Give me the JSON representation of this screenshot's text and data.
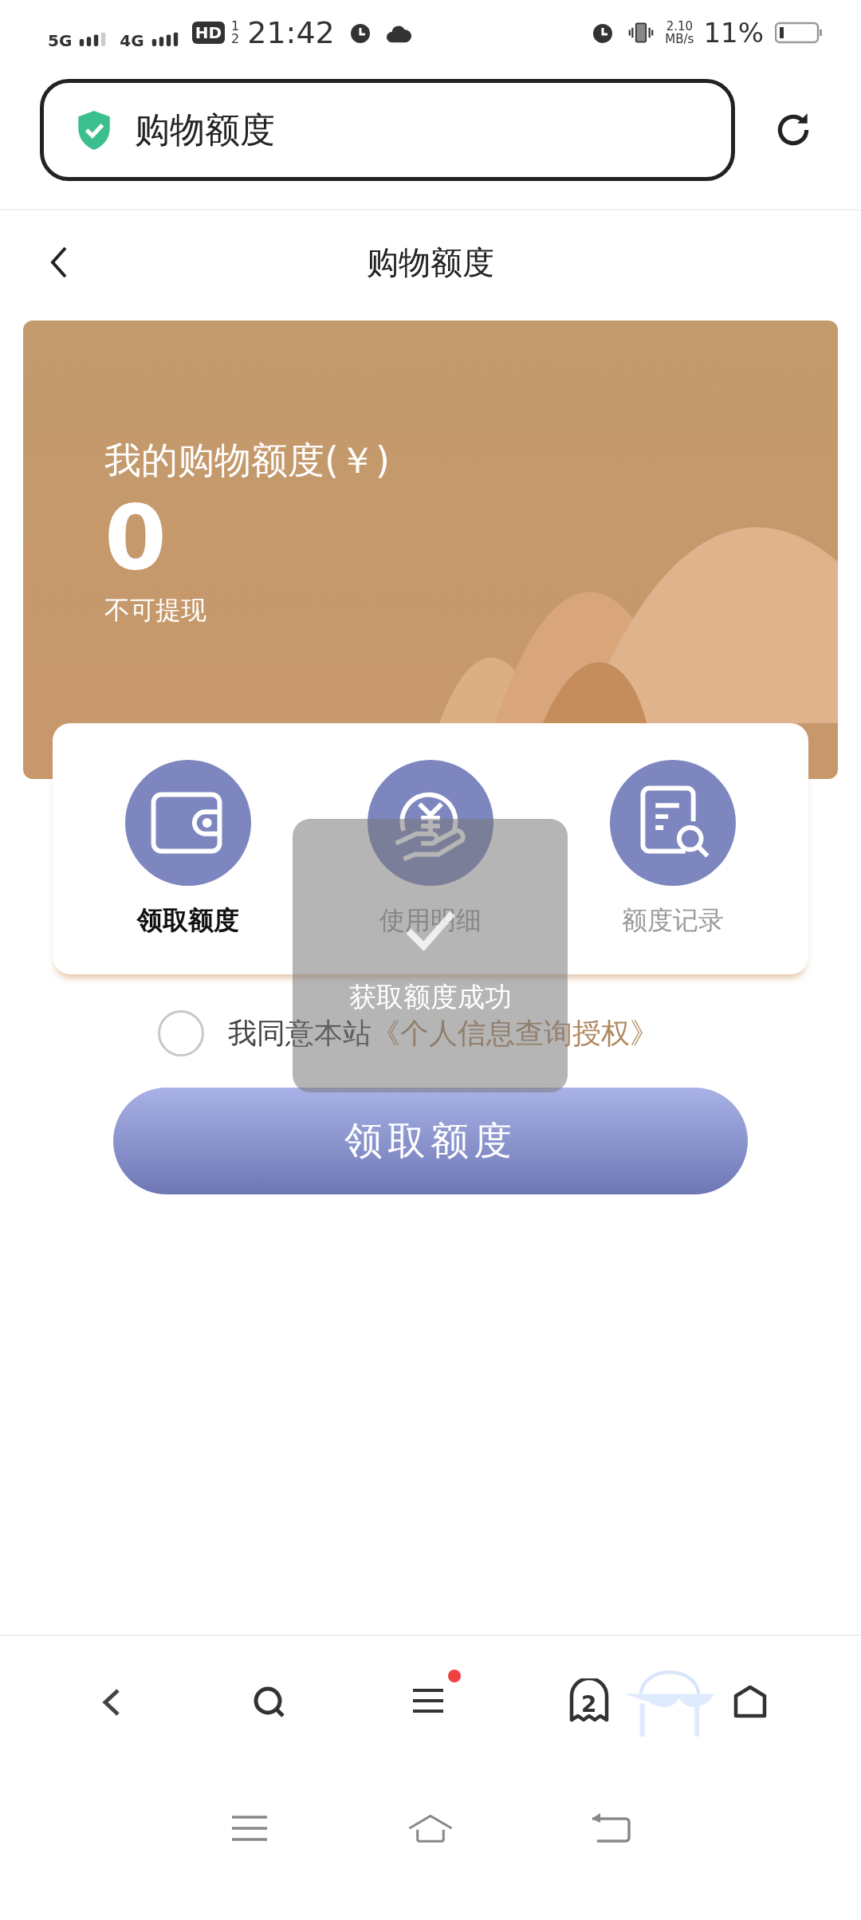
{
  "status_bar": {
    "network_1": "5G",
    "network_2": "4G",
    "hd": "HD",
    "sim_slots": [
      "1",
      "2"
    ],
    "time": "21:42",
    "speed": "2.10",
    "speed_unit": "MB/s",
    "battery": "11%"
  },
  "address_bar": {
    "title": "购物额度"
  },
  "page_header": {
    "title": "购物额度"
  },
  "balance_card": {
    "label": "我的购物额度(￥)",
    "amount": "0",
    "note": "不可提现"
  },
  "actions": [
    {
      "kind": "wallet",
      "label": "领取额度",
      "selected": true
    },
    {
      "kind": "yuan",
      "label": "使用明细",
      "selected": false
    },
    {
      "kind": "record",
      "label": "额度记录",
      "selected": false
    }
  ],
  "agreement": {
    "checked": false,
    "text": "我同意本站",
    "link": "《个人信息查询授权》"
  },
  "submit_button": "领取额度",
  "toast": {
    "text": "获取额度成功"
  },
  "browser_toolbar": {
    "tab_count": "2",
    "menu_badge": true
  }
}
